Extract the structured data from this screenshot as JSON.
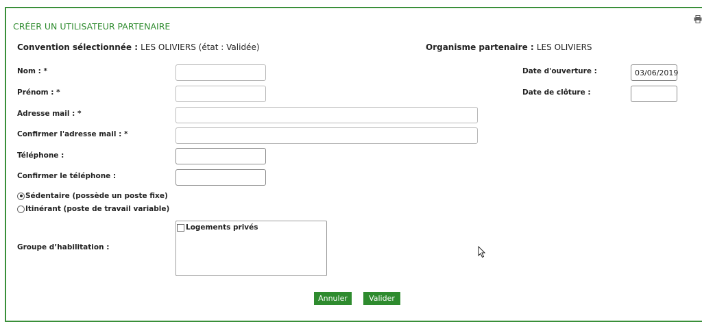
{
  "title": "CRÉER UN UTILISATEUR PARTENAIRE",
  "convention": {
    "label": "Convention sélectionnée : ",
    "value": "LES OLIVIERS (état : Validée)"
  },
  "organisme": {
    "label": "Organisme partenaire : ",
    "value": "LES OLIVIERS"
  },
  "fields": {
    "nom": {
      "label": "Nom : *",
      "value": ""
    },
    "prenom": {
      "label": "Prénom : *",
      "value": ""
    },
    "email": {
      "label": "Adresse mail : *",
      "value": ""
    },
    "email_confirm": {
      "label": "Confirmer l'adresse mail : *",
      "value": ""
    },
    "telephone": {
      "label": "Téléphone :",
      "value": ""
    },
    "telephone_confirm": {
      "label": "Confirmer le téléphone :",
      "value": ""
    },
    "date_ouverture": {
      "label": "Date d'ouverture :",
      "value": "03/06/2019"
    },
    "date_cloture": {
      "label": "Date de clôture :",
      "value": ""
    }
  },
  "poste": {
    "options": [
      {
        "label": "Sédentaire (possède un poste fixe)",
        "selected": true
      },
      {
        "label": "Itinérant (poste de travail variable)",
        "selected": false
      }
    ]
  },
  "groupe": {
    "label": "Groupe d’habilitation :",
    "options": [
      {
        "label": "Logements privés",
        "checked": false
      }
    ]
  },
  "buttons": {
    "cancel": "Annuler",
    "submit": "Valider"
  },
  "icons": {
    "print": "print-icon",
    "cursor": "mouse-pointer-icon"
  },
  "colors": {
    "accent": "#2e8b2e",
    "border": "#3a8f3a"
  }
}
